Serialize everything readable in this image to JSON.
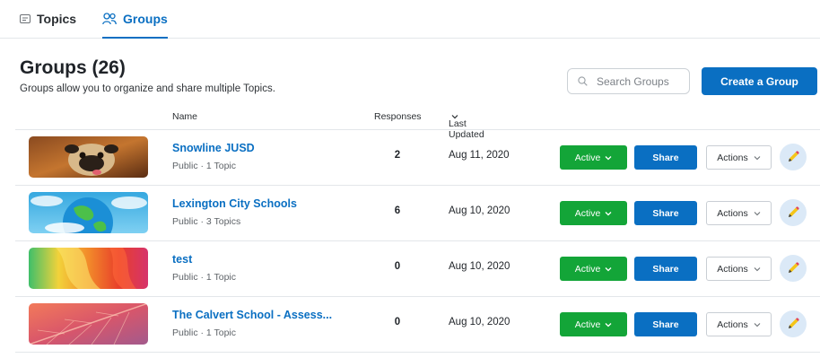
{
  "tabs": [
    {
      "label": "Topics",
      "icon": "topics-icon"
    },
    {
      "label": "Groups",
      "icon": "groups-icon",
      "selected": true
    }
  ],
  "header": {
    "title": "Groups (26)",
    "subtitle": "Groups allow you to organize and share multiple Topics."
  },
  "search": {
    "placeholder": "Search Groups"
  },
  "create_label": "Create a Group",
  "columns": {
    "name": "Name",
    "responses": "Responses",
    "updated": "Last Updated"
  },
  "buttons": {
    "active": "Active",
    "share": "Share",
    "actions": "Actions"
  },
  "colors": {
    "accent": "#0a6fc2",
    "active_green": "#13a538"
  },
  "groups": [
    {
      "name": "Snowline JUSD",
      "meta": "Public · 1 Topic",
      "responses": "2",
      "updated": "Aug 11, 2020",
      "thumbnail": "pug-photo"
    },
    {
      "name": "Lexington City Schools",
      "meta": "Public · 3 Topics",
      "responses": "6",
      "updated": "Aug 10, 2020",
      "thumbnail": "globe-illustration"
    },
    {
      "name": "test",
      "meta": "Public · 1 Topic",
      "responses": "0",
      "updated": "Aug 10, 2020",
      "thumbnail": "colorful-abstract"
    },
    {
      "name": "The Calvert School - Assess...",
      "meta": "Public · 1 Topic",
      "responses": "0",
      "updated": "Aug 10, 2020",
      "thumbnail": "leaf-macro"
    }
  ]
}
